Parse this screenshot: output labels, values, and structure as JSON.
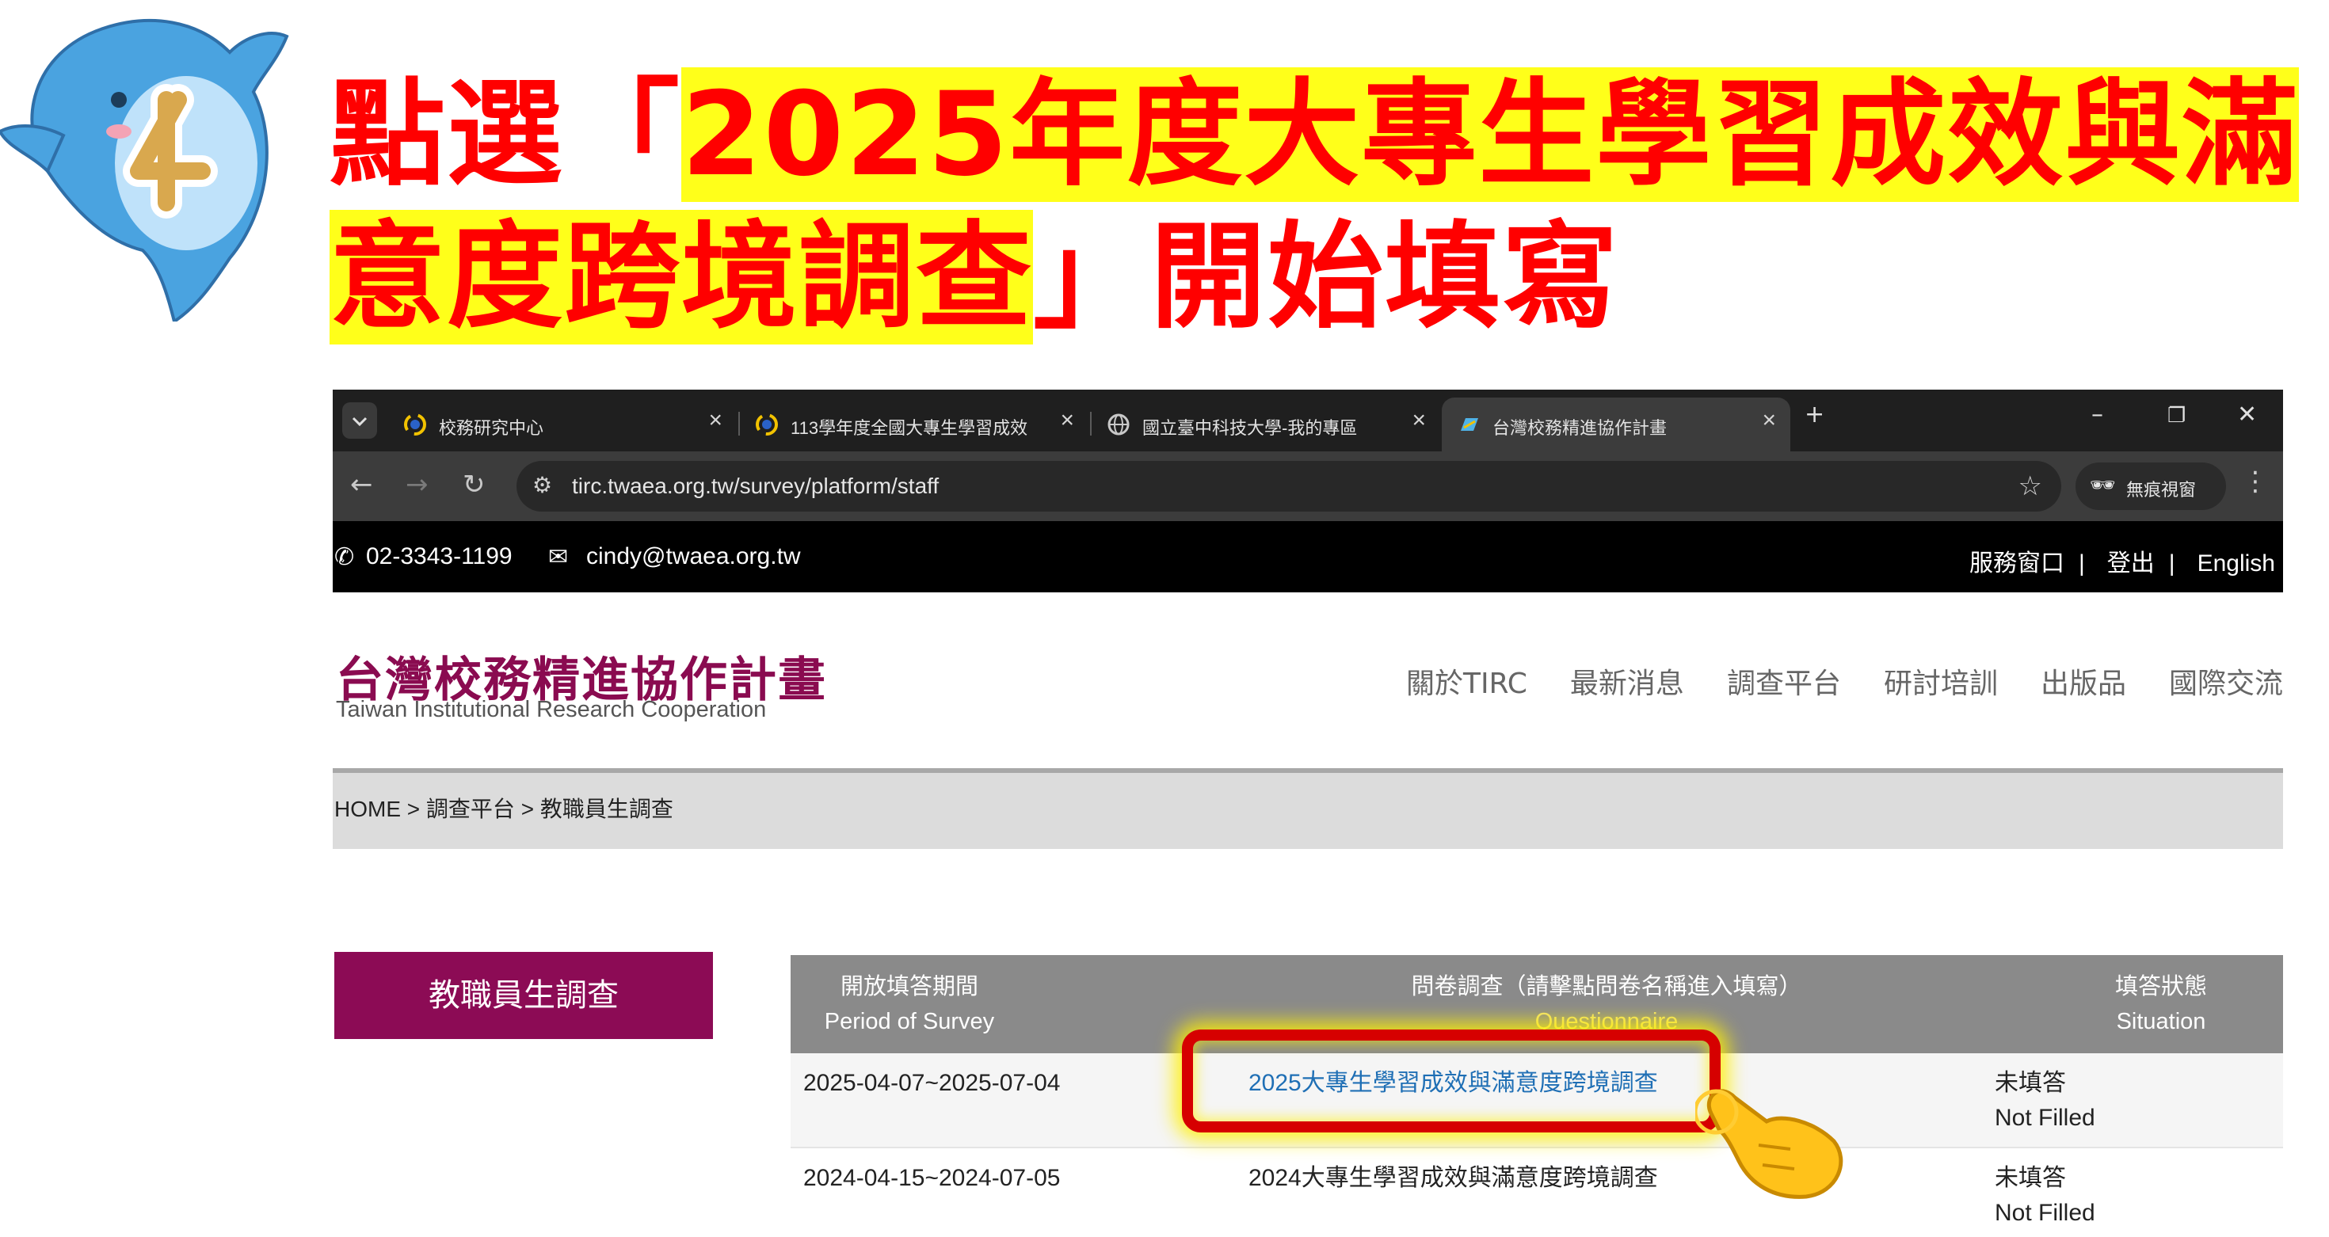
{
  "instruction": {
    "step_number": "4",
    "line1_prefix": "點選「",
    "line1_highlight": "2025年度大專生學習成效與滿",
    "line2_highlight": "意度跨境調查",
    "line2_suffix": "」開始填寫"
  },
  "colors": {
    "instruction_text": "#ff0000",
    "highlight": "#ffff1a",
    "brand": "#8a0b50",
    "sidebar_button": "#8c0b55",
    "table_header": "#8a8a8a",
    "link": "#1f6fb5",
    "annotation_box": "#d60000"
  },
  "browser": {
    "tabs": [
      {
        "title": "校務研究中心",
        "favicon": "spinner-favicon-icon"
      },
      {
        "title": "113學年度全國大專生學習成效",
        "favicon": "spinner-favicon-icon"
      },
      {
        "title": "國立臺中科技大學-我的專區",
        "favicon": "globe-icon"
      },
      {
        "title": "台灣校務精進協作計畫",
        "favicon": "tirc-favicon-icon"
      }
    ],
    "url": "tirc.twaea.org.tw/survey/platform/staff",
    "incognito_label": "無痕視窗"
  },
  "site": {
    "phone": "02-3343-1199",
    "email": "cindy@twaea.org.tw",
    "top_links": [
      "服務窗口",
      "登出",
      "English"
    ],
    "brand_zh": "台灣校務精進協作計畫",
    "brand_en": "Taiwan Institutional Research Cooperation",
    "nav": [
      "關於TIRC",
      "最新消息",
      "調查平台",
      "研討培訓",
      "出版品",
      "國際交流"
    ],
    "breadcrumb": "HOME > 調查平台 > 教職員生調查",
    "sidebar_button": "教職員生調查"
  },
  "table": {
    "headers": [
      {
        "zh": "開放填答期間",
        "en": "Period of Survey"
      },
      {
        "zh": "問卷調查（請擊點問卷名稱進入填寫）",
        "en": "Questionnaire"
      },
      {
        "zh": "填答狀態",
        "en": "Situation"
      }
    ],
    "rows": [
      {
        "period": "2025-04-07~2025-07-04",
        "name": "2025大專生學習成效與滿意度跨境調查",
        "status_zh": "未填答",
        "status_en": "Not Filled"
      },
      {
        "period": "2024-04-15~2024-07-05",
        "name": "2024大專生學習成效與滿意度跨境調查",
        "status_zh": "未填答",
        "status_en": "Not Filled"
      }
    ]
  }
}
